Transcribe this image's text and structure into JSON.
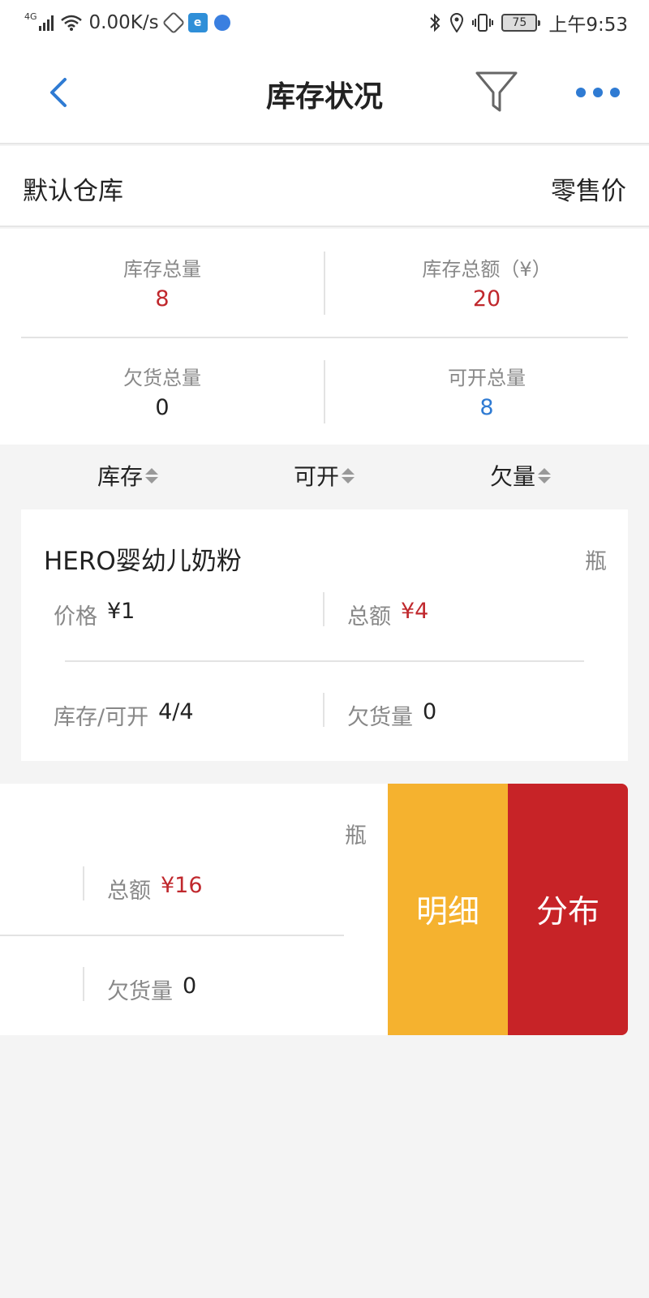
{
  "status_bar": {
    "network": "4G",
    "speed": "0.00K/s",
    "battery": "75",
    "time": "上午9:53"
  },
  "nav": {
    "title": "库存状况",
    "icons": [
      "back-chevron-icon",
      "filter-funnel-icon",
      "more-dots-icon"
    ]
  },
  "warehouse": {
    "name": "默认仓库",
    "price_type": "零售价"
  },
  "summary": {
    "total_qty_label": "库存总量",
    "total_qty": "8",
    "total_amount_label": "库存总额（¥）",
    "total_amount": "20",
    "backorder_label": "欠货总量",
    "backorder": "0",
    "available_label": "可开总量",
    "available": "8"
  },
  "sort": {
    "stock": "库存",
    "available": "可开",
    "owed": "欠量"
  },
  "products": [
    {
      "name": "HERO婴幼儿奶粉",
      "unit": "瓶",
      "price_label": "价格",
      "price": "¥1",
      "amount_label": "总额",
      "amount": "¥4",
      "stock_label": "库存/可开",
      "stock": "4/4",
      "owed_label": "欠货量",
      "owed": "0"
    },
    {
      "unit": "瓶",
      "amount_label": "总额",
      "amount": "¥16",
      "owed_label": "欠货量",
      "owed": "0"
    }
  ],
  "actions": {
    "detail": "明细",
    "distribution": "分布"
  },
  "colors": {
    "accent_blue": "#2f7bd3",
    "value_red": "#c0282d",
    "detail_orange": "#f5b22f",
    "distribution_red": "#c72327"
  }
}
